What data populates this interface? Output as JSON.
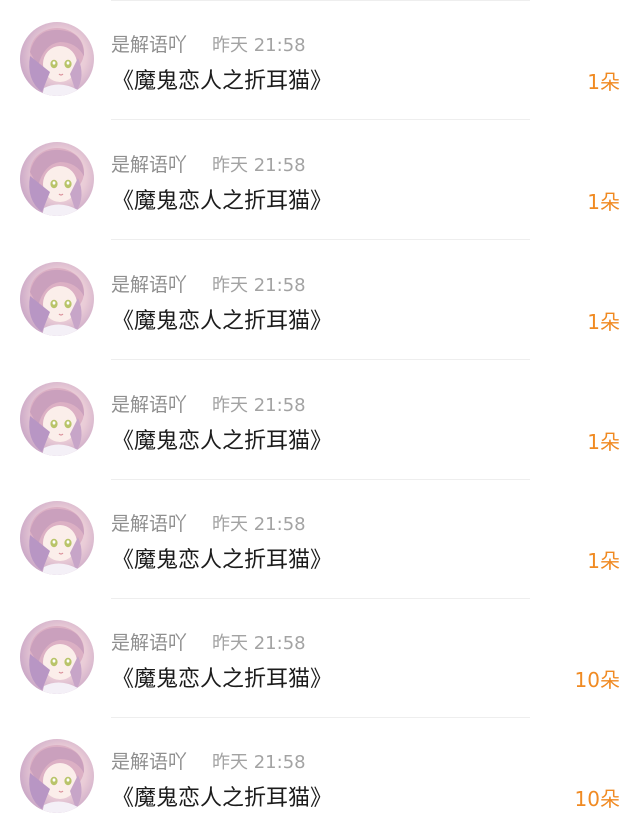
{
  "gift_list": {
    "items": [
      {
        "user": "是解语吖",
        "time": "昨天 21:58",
        "title": "《魔鬼恋人之折耳猫》",
        "gift": "1朵",
        "avatar_icon": "anime-girl-avatar-icon"
      },
      {
        "user": "是解语吖",
        "time": "昨天 21:58",
        "title": "《魔鬼恋人之折耳猫》",
        "gift": "1朵",
        "avatar_icon": "anime-girl-avatar-icon"
      },
      {
        "user": "是解语吖",
        "time": "昨天 21:58",
        "title": "《魔鬼恋人之折耳猫》",
        "gift": "1朵",
        "avatar_icon": "anime-girl-avatar-icon"
      },
      {
        "user": "是解语吖",
        "time": "昨天 21:58",
        "title": "《魔鬼恋人之折耳猫》",
        "gift": "1朵",
        "avatar_icon": "anime-girl-avatar-icon"
      },
      {
        "user": "是解语吖",
        "time": "昨天 21:58",
        "title": "《魔鬼恋人之折耳猫》",
        "gift": "1朵",
        "avatar_icon": "anime-girl-avatar-icon"
      },
      {
        "user": "是解语吖",
        "time": "昨天 21:58",
        "title": "《魔鬼恋人之折耳猫》",
        "gift": "10朵",
        "avatar_icon": "anime-girl-avatar-icon"
      },
      {
        "user": "是解语吖",
        "time": "昨天 21:58",
        "title": "《魔鬼恋人之折耳猫》",
        "gift": "10朵",
        "avatar_icon": "anime-girl-avatar-icon"
      }
    ]
  },
  "colors": {
    "accent": "#f08a22",
    "username": "#8f8f8f",
    "time": "#a3a3a3",
    "title": "#1c1c1c",
    "divider": "#eeeeee"
  }
}
